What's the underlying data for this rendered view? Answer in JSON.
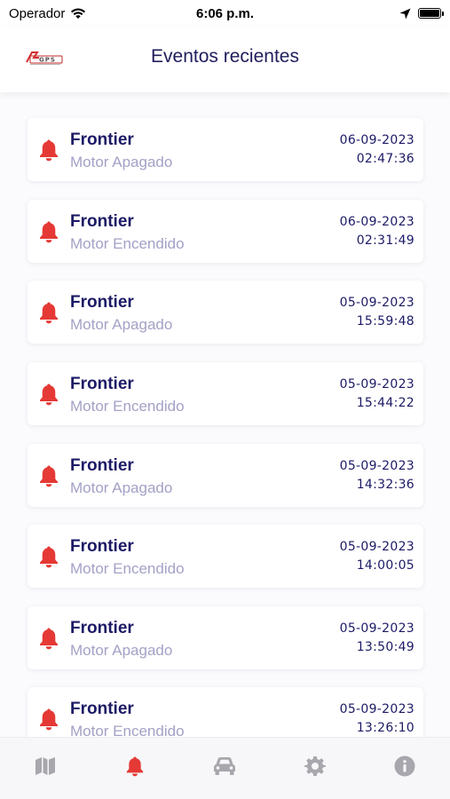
{
  "status_bar": {
    "carrier": "Operador",
    "time": "6:06 p.m."
  },
  "header": {
    "title": "Eventos recientes",
    "logo_text": "GPS"
  },
  "colors": {
    "accent_red": "#e53935",
    "title_navy": "#1c1a66",
    "subtitle_lavender": "#a3a1c6",
    "tab_gray": "#a7a7ad"
  },
  "events": [
    {
      "name": "Frontier",
      "description": "Motor Apagado",
      "date": "06-09-2023",
      "time": "02:47:36"
    },
    {
      "name": "Frontier",
      "description": "Motor Encendido",
      "date": "06-09-2023",
      "time": "02:31:49"
    },
    {
      "name": "Frontier",
      "description": "Motor Apagado",
      "date": "05-09-2023",
      "time": "15:59:48"
    },
    {
      "name": "Frontier",
      "description": "Motor Encendido",
      "date": "05-09-2023",
      "time": "15:44:22"
    },
    {
      "name": "Frontier",
      "description": "Motor Apagado",
      "date": "05-09-2023",
      "time": "14:32:36"
    },
    {
      "name": "Frontier",
      "description": "Motor Encendido",
      "date": "05-09-2023",
      "time": "14:00:05"
    },
    {
      "name": "Frontier",
      "description": "Motor Apagado",
      "date": "05-09-2023",
      "time": "13:50:49"
    },
    {
      "name": "Frontier",
      "description": "Motor Encendido",
      "date": "05-09-2023",
      "time": "13:26:10"
    }
  ],
  "tab_bar": {
    "tabs": [
      {
        "icon": "map-icon",
        "active": false
      },
      {
        "icon": "bell-icon",
        "active": true
      },
      {
        "icon": "car-icon",
        "active": false
      },
      {
        "icon": "gear-icon",
        "active": false
      },
      {
        "icon": "info-icon",
        "active": false
      }
    ]
  }
}
